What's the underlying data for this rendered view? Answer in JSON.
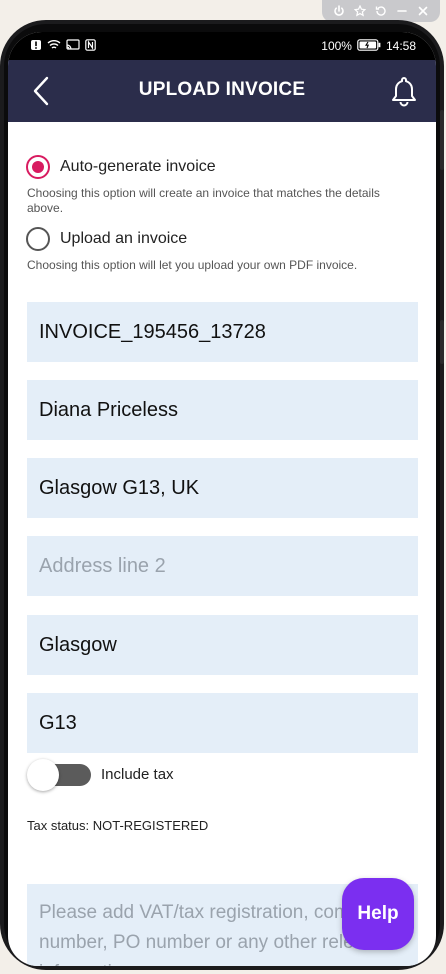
{
  "emulator": {
    "icons": [
      "power-icon",
      "pin-icon",
      "rotate-icon",
      "minimize-icon",
      "close-icon"
    ]
  },
  "statusbar": {
    "battery": "100%",
    "time": "14:58"
  },
  "header": {
    "title": "UPLOAD INVOICE"
  },
  "invoice_options": [
    {
      "label": "Auto-generate invoice",
      "hint": "Choosing this option will create an invoice that matches the details above.",
      "selected": true
    },
    {
      "label": "Upload an invoice",
      "hint": "Choosing this option will let you upload your own PDF invoice.",
      "selected": false
    }
  ],
  "form": {
    "invoice_number": {
      "value": "INVOICE_195456_13728",
      "placeholder": ""
    },
    "name": {
      "value": "Diana Priceless",
      "placeholder": ""
    },
    "address_line_1": {
      "value": "Glasgow G13, UK",
      "placeholder": ""
    },
    "address_line_2": {
      "value": "",
      "placeholder": "Address line 2"
    },
    "city": {
      "value": "Glasgow",
      "placeholder": ""
    },
    "postcode": {
      "value": "G13",
      "placeholder": ""
    },
    "include_tax": {
      "label": "Include tax",
      "on": false
    },
    "tax_status": "Tax status: NOT-REGISTERED",
    "notes": {
      "value": "",
      "placeholder": "Please add VAT/tax registration, company number, PO number or any other relevant information."
    }
  },
  "help": {
    "label": "Help"
  },
  "colors": {
    "appbar": "#2b2d4b",
    "accent_radio": "#d81b60",
    "field_bg": "#e4eef8",
    "help_button": "#7b2ff0"
  }
}
